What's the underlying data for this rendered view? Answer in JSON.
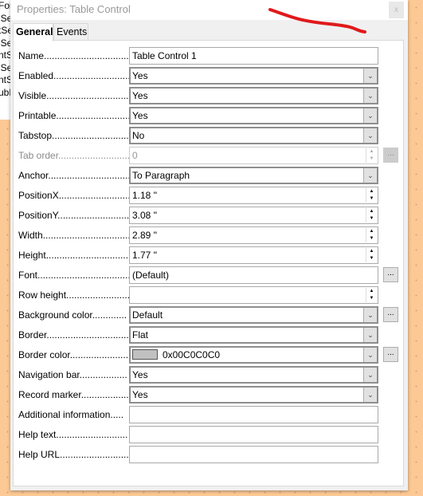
{
  "background_items": [
    "For",
    "lSe",
    "tSe",
    "lSe",
    "ntS",
    "lSe",
    "ntS",
    "ubF"
  ],
  "dialog": {
    "title": "Properties: Table Control",
    "close_label": "x"
  },
  "tabs": [
    {
      "label": "General",
      "active": true
    },
    {
      "label": "Events",
      "active": false
    }
  ],
  "colors": {
    "border_color_swatch": "#C0C0C0",
    "annotation": "#e0191b"
  },
  "rows": [
    {
      "label": "Name.................................",
      "value": "Table Control  1",
      "type": "text"
    },
    {
      "label": "Enabled..............................",
      "value": "Yes",
      "type": "select"
    },
    {
      "label": "Visible...............................",
      "value": "Yes",
      "type": "select"
    },
    {
      "label": "Printable............................",
      "value": "Yes",
      "type": "select"
    },
    {
      "label": "Tabstop..............................",
      "value": "No",
      "type": "select"
    },
    {
      "label": "Tab order............................",
      "value": "0",
      "type": "spin",
      "disabled": true,
      "ellipsis": "..."
    },
    {
      "label": "Anchor...............................",
      "value": "To Paragraph",
      "type": "select"
    },
    {
      "label": "PositionX...........................",
      "value": "1.18 \"",
      "type": "spin"
    },
    {
      "label": "PositionY...........................",
      "value": "3.08 \"",
      "type": "spin"
    },
    {
      "label": "Width.................................",
      "value": "2.89 \"",
      "type": "spin"
    },
    {
      "label": "Height................................",
      "value": "1.77 \"",
      "type": "spin"
    },
    {
      "label": "Font...................................",
      "value": "(Default)",
      "type": "text",
      "ellipsis": "..."
    },
    {
      "label": "Row height.........................",
      "value": "",
      "type": "spin"
    },
    {
      "label": "Background color.............",
      "value": "Default",
      "type": "select",
      "ellipsis": "..."
    },
    {
      "label": "Border...............................",
      "value": "Flat",
      "type": "select"
    },
    {
      "label": "Border color.......................",
      "value": "0x00C0C0C0",
      "type": "color",
      "ellipsis": "..."
    },
    {
      "label": "Navigation bar..................",
      "value": "Yes",
      "type": "select"
    },
    {
      "label": "Record marker...................",
      "value": "Yes",
      "type": "select"
    },
    {
      "label": "Additional information.....",
      "value": "",
      "type": "text"
    },
    {
      "label": "Help text...........................",
      "value": "",
      "type": "text"
    },
    {
      "label": "Help URL...........................",
      "value": "",
      "type": "text"
    }
  ]
}
